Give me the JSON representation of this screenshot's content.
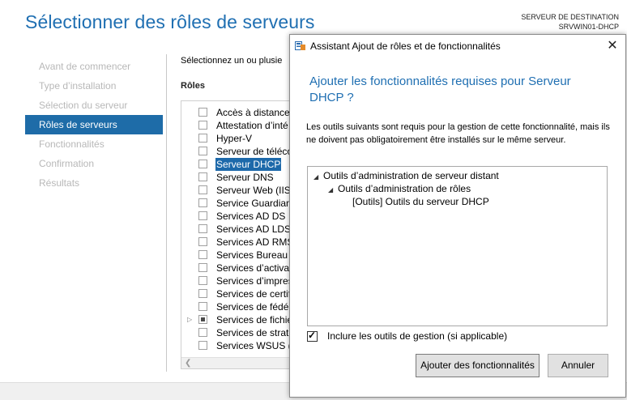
{
  "wizard": {
    "title": "Sélectionner des rôles de serveurs",
    "destination_label": "SERVEUR DE DESTINATION",
    "destination_server": "SRVWIN01-DHCP",
    "nav": [
      {
        "label": "Avant de commencer",
        "active": false
      },
      {
        "label": "Type d’installation",
        "active": false
      },
      {
        "label": "Sélection du serveur",
        "active": false
      },
      {
        "label": "Rôles de serveurs",
        "active": true
      },
      {
        "label": "Fonctionnalités",
        "active": false
      },
      {
        "label": "Confirmation",
        "active": false
      },
      {
        "label": "Résultats",
        "active": false
      }
    ],
    "intro_text": "Sélectionnez un ou plusie",
    "roles_header": "Rôles",
    "roles": [
      {
        "label": "Accès à distance",
        "selected": false
      },
      {
        "label": "Attestation d’inté",
        "selected": false
      },
      {
        "label": "Hyper-V",
        "selected": false
      },
      {
        "label": "Serveur de téléco",
        "selected": false
      },
      {
        "label": "Serveur DHCP",
        "selected": true
      },
      {
        "label": "Serveur DNS",
        "selected": false
      },
      {
        "label": "Serveur Web (IIS)",
        "selected": false
      },
      {
        "label": "Service Guardian",
        "selected": false
      },
      {
        "label": "Services AD DS",
        "selected": false
      },
      {
        "label": "Services AD LDS (",
        "selected": false
      },
      {
        "label": "Services AD RMS",
        "selected": false
      },
      {
        "label": "Services Bureau à",
        "selected": false
      },
      {
        "label": "Services d’activati",
        "selected": false
      },
      {
        "label": "Services d’impres",
        "selected": false
      },
      {
        "label": "Services de certifi",
        "selected": false
      },
      {
        "label": "Services de fédéra",
        "selected": false
      },
      {
        "label": "Services de fichie",
        "selected": false,
        "partial": true,
        "expandable": true
      },
      {
        "label": "Services de straté",
        "selected": false
      },
      {
        "label": "Services WSUS (W",
        "selected": false
      }
    ]
  },
  "dialog": {
    "title": "Assistant Ajout de rôles et de fonctionnalités",
    "close_glyph": "✕",
    "heading": "Ajouter les fonctionnalités requises pour Serveur DHCP ?",
    "description": "Les outils suivants sont requis pour la gestion de cette fonctionnalité, mais ils ne doivent pas obligatoirement être installés sur le même serveur.",
    "tree": [
      {
        "label": "Outils d’administration de serveur distant",
        "level": 0,
        "expanded": true
      },
      {
        "label": "Outils d’administration de rôles",
        "level": 1,
        "expanded": true
      },
      {
        "label": "[Outils] Outils du serveur DHCP",
        "level": 2,
        "expanded": false
      }
    ],
    "include_label": "Inclure les outils de gestion (si applicable)",
    "include_checked": true,
    "add_button": "Ajouter des fonctionnalités",
    "cancel_button": "Annuler"
  },
  "colors": {
    "accent": "#1f6fb2",
    "nav_active_bg": "#1e6ca8",
    "selection_bg": "#1d69aa"
  }
}
